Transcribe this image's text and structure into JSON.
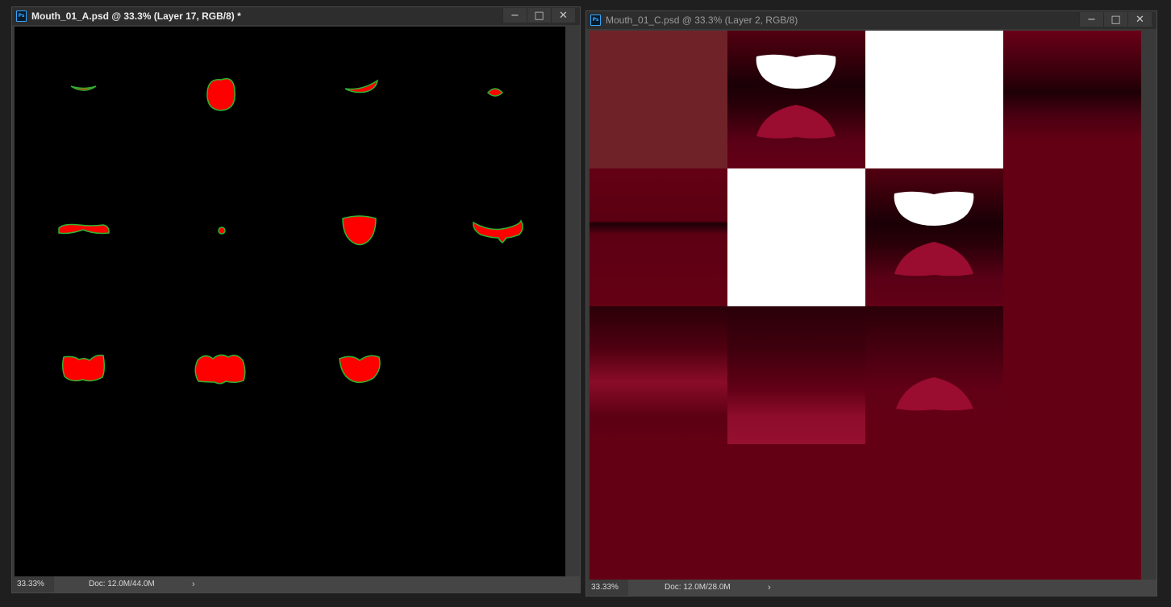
{
  "windows": {
    "a": {
      "title": "Mouth_01_A.psd @ 33.3% (Layer 17, RGB/8) *",
      "zoom": "33.33%",
      "doc_info": "Doc: 12.0M/44.0M",
      "active": true
    },
    "c": {
      "title": "Mouth_01_C.psd @ 33.3% (Layer 2, RGB/8)",
      "zoom": "33.33%",
      "doc_info": "Doc: 12.0M/28.0M",
      "active": false
    }
  },
  "controls": {
    "minimize": "−",
    "maximize": "□",
    "close": "✕",
    "status_arrow": "›"
  },
  "app_icon": "Ps",
  "colors": {
    "accent_ps": "#31a8ff",
    "mask_red": "#ff0000",
    "mask_outline": "#2fb52f",
    "texture_dark_red": "#640014",
    "lip_crimson": "#9a0c30"
  }
}
